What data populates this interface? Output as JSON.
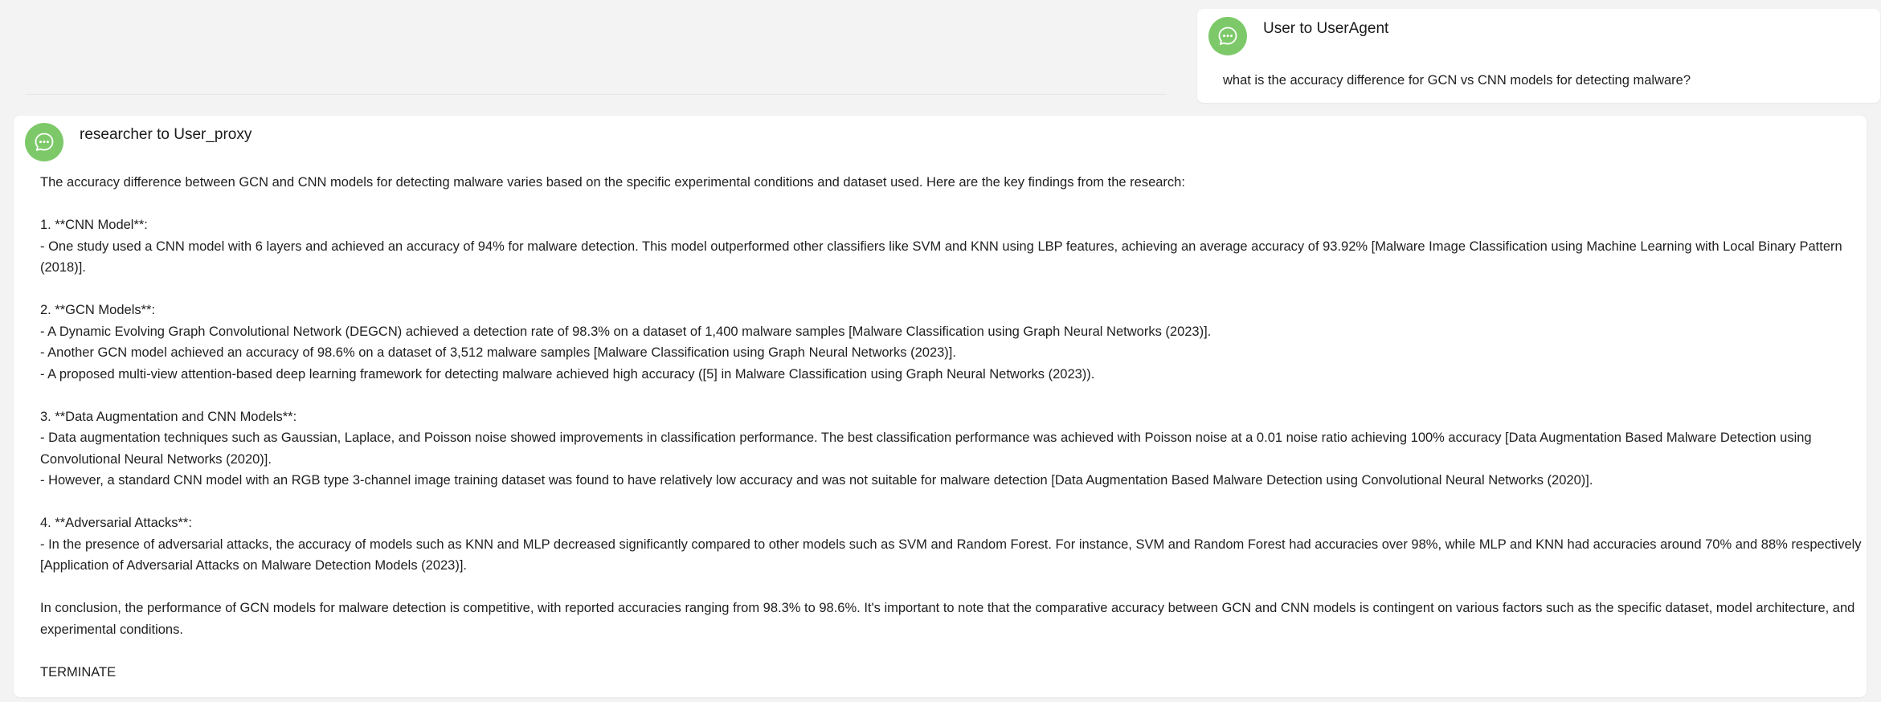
{
  "colors": {
    "avatar_bg": "#7dc96a",
    "avatar_icon": "#ffffff",
    "page_bg": "#f3f3f3",
    "card_bg": "#ffffff"
  },
  "user_message": {
    "avatar_icon": "chat-bubble-icon",
    "sender": "User to UserAgent",
    "text": "what is the accuracy difference for GCN vs CNN models for detecting malware?"
  },
  "reply": {
    "avatar_icon": "chat-bubble-icon",
    "sender": "researcher to User_proxy",
    "paragraphs": [
      "The accuracy difference between GCN and CNN models for detecting malware varies based on the specific experimental conditions and dataset used. Here are the key findings from the research:",
      "1. **CNN Model**:\n- One study used a CNN model with 6 layers and achieved an accuracy of 94% for malware detection. This model outperformed other classifiers like SVM and KNN using LBP features, achieving an average accuracy of 93.92% [Malware Image Classification using Machine Learning with Local Binary Pattern (2018)].",
      "2. **GCN Models**:\n- A Dynamic Evolving Graph Convolutional Network (DEGCN) achieved a detection rate of 98.3% on a dataset of 1,400 malware samples [Malware Classification using Graph Neural Networks (2023)].\n- Another GCN model achieved an accuracy of 98.6% on a dataset of 3,512 malware samples [Malware Classification using Graph Neural Networks (2023)].\n- A proposed multi-view attention-based deep learning framework for detecting malware achieved high accuracy ([5] in Malware Classification using Graph Neural Networks (2023)).",
      "3. **Data Augmentation and CNN Models**:\n- Data augmentation techniques such as Gaussian, Laplace, and Poisson noise showed improvements in classification performance. The best classification performance was achieved with Poisson noise at a 0.01 noise ratio achieving 100% accuracy [Data Augmentation Based Malware Detection using Convolutional Neural Networks (2020)].\n- However, a standard CNN model with an RGB type 3-channel image training dataset was found to have relatively low accuracy and was not suitable for malware detection [Data Augmentation Based Malware Detection using Convolutional Neural Networks (2020)].",
      "4. **Adversarial Attacks**:\n- In the presence of adversarial attacks, the accuracy of models such as KNN and MLP decreased significantly compared to other models such as SVM and Random Forest. For instance, SVM and Random Forest had accuracies over 98%, while MLP and KNN had accuracies around 70% and 88% respectively [Application of Adversarial Attacks on Malware Detection Models (2023)].",
      "In conclusion, the performance of GCN models for malware detection is competitive, with reported accuracies ranging from 98.3% to 98.6%. It's important to note that the comparative accuracy between GCN and CNN models is contingent on various factors such as the specific dataset, model architecture, and experimental conditions.",
      "TERMINATE"
    ]
  }
}
